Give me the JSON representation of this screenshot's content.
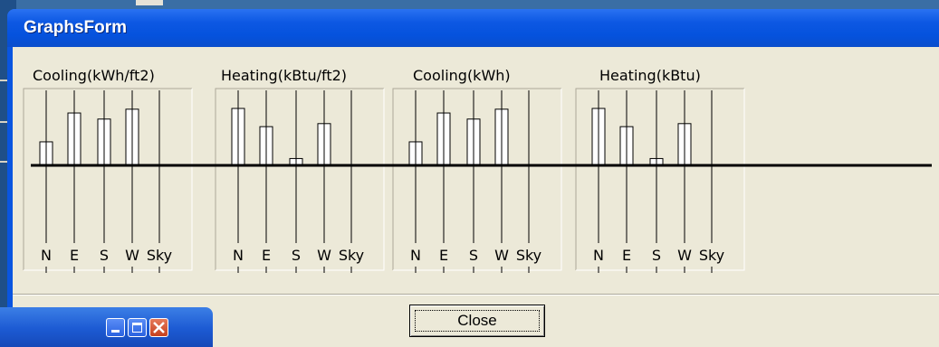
{
  "window": {
    "title": "GraphsForm"
  },
  "buttons": {
    "close_label": "Close"
  },
  "colors": {
    "titlebar": "#0a55e0",
    "client": "#ece9d8",
    "bar_fill": "#ffffff",
    "baseline": "#000000"
  },
  "chart_data": [
    {
      "type": "bar",
      "title": "Cooling(kWh/ft2)",
      "categories": [
        "N",
        "E",
        "S",
        "W",
        "Sky"
      ],
      "values": [
        31,
        69,
        61,
        74,
        0
      ]
    },
    {
      "type": "bar",
      "title": "Heating(kBtu/ft2)",
      "categories": [
        "N",
        "E",
        "S",
        "W",
        "Sky"
      ],
      "values": [
        75,
        51,
        9,
        55,
        0
      ]
    },
    {
      "type": "bar",
      "title": "Cooling(kWh)",
      "categories": [
        "N",
        "E",
        "S",
        "W",
        "Sky"
      ],
      "values": [
        31,
        69,
        61,
        74,
        0
      ]
    },
    {
      "type": "bar",
      "title": "Heating(kBtu)",
      "categories": [
        "N",
        "E",
        "S",
        "W",
        "Sky"
      ],
      "values": [
        75,
        51,
        9,
        55,
        0
      ]
    }
  ]
}
